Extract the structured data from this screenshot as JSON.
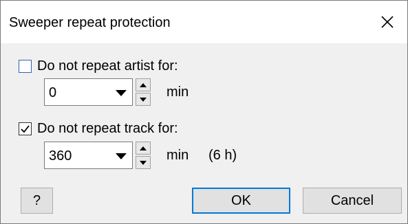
{
  "dialog": {
    "title": "Sweeper repeat protection"
  },
  "artist_option": {
    "label": "Do not repeat artist for:",
    "checked": false,
    "value": "0",
    "unit": "min"
  },
  "track_option": {
    "label": "Do not repeat track for:",
    "checked": true,
    "value": "360",
    "unit": "min",
    "extra": "(6 h)"
  },
  "buttons": {
    "help": "?",
    "ok": "OK",
    "cancel": "Cancel"
  },
  "colors": {
    "accent": "#0078d7",
    "button_face": "#e1e1e1",
    "window_bg": "#f0f0f0"
  }
}
